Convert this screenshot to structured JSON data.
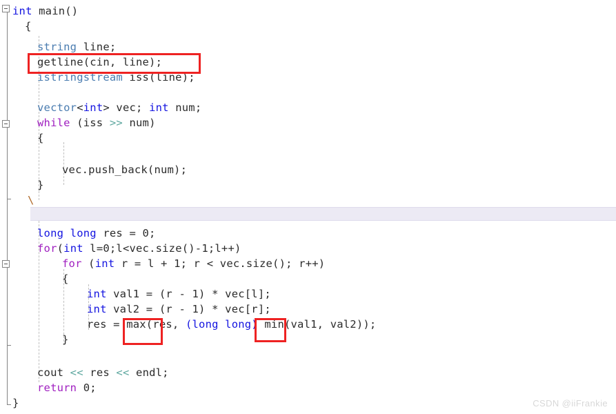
{
  "editor": {
    "language": "C++",
    "background_color": "#ffffff",
    "text_color": "#2b2b2b",
    "highlight_color": "#eceaf4",
    "annotation_color": "#ee2222"
  },
  "colors": {
    "keyword": "#a020c0",
    "type": "#1414e0",
    "class": "#4a7cb0",
    "operator": "#5fa8a0",
    "plain": "#2b2b2b",
    "backslash": "#b06a2a",
    "gutter_line": "#838383",
    "indent_guide": "#bfbfbf"
  },
  "code_lines": [
    {
      "indent": 0,
      "text": "int main()"
    },
    {
      "indent": 1,
      "text": "{"
    },
    {
      "indent": 0,
      "text": ""
    },
    {
      "indent": 2,
      "text": "string line;"
    },
    {
      "indent": 2,
      "text": "getline(cin, line);"
    },
    {
      "indent": 2,
      "text": "istringstream iss(line);"
    },
    {
      "indent": 0,
      "text": ""
    },
    {
      "indent": 2,
      "text": "vector<int> vec; int num;"
    },
    {
      "indent": 2,
      "text": "while (iss >> num)"
    },
    {
      "indent": 2,
      "text": "{"
    },
    {
      "indent": 0,
      "text": ""
    },
    {
      "indent": 3,
      "text": "vec.push_back(num);"
    },
    {
      "indent": 2,
      "text": "}"
    },
    {
      "indent": 2,
      "text": "\\"
    },
    {
      "indent": 0,
      "text": ""
    },
    {
      "indent": 2,
      "text": "long long res = 0;"
    },
    {
      "indent": 2,
      "text": "for(int l=0;l<vec.size()-1;l++)"
    },
    {
      "indent": 3,
      "text": "for (int r = l + 1; r < vec.size(); r++)"
    },
    {
      "indent": 3,
      "text": "{"
    },
    {
      "indent": 4,
      "text": "int val1 = (r - 1) * vec[l];"
    },
    {
      "indent": 4,
      "text": "int val2 = (r - 1) * vec[r];"
    },
    {
      "indent": 4,
      "text": "res = max(res, (long long) min(val1, val2));"
    },
    {
      "indent": 3,
      "text": "}"
    },
    {
      "indent": 0,
      "text": ""
    },
    {
      "indent": 2,
      "text": "cout << res << endl;"
    },
    {
      "indent": 2,
      "text": "return 0;"
    },
    {
      "indent": 1,
      "text": "}"
    }
  ],
  "annotations": [
    {
      "id": "getline-box",
      "target": "getline(cin, line);",
      "note": "red rectangle around the getline call"
    },
    {
      "id": "max-box",
      "target": "max(re",
      "note": "red rectangle around max("
    },
    {
      "id": "min-box",
      "target": "min(v",
      "note": "red rectangle around min("
    }
  ],
  "fold_markers": [
    {
      "id": "fold-main",
      "state": "expanded",
      "glyph": "minus-box"
    },
    {
      "id": "fold-while",
      "state": "expanded",
      "glyph": "minus-box"
    },
    {
      "id": "fold-inner-for",
      "state": "expanded",
      "glyph": "minus-box"
    }
  ],
  "watermark": {
    "text": "CSDN @iiFrankie"
  }
}
